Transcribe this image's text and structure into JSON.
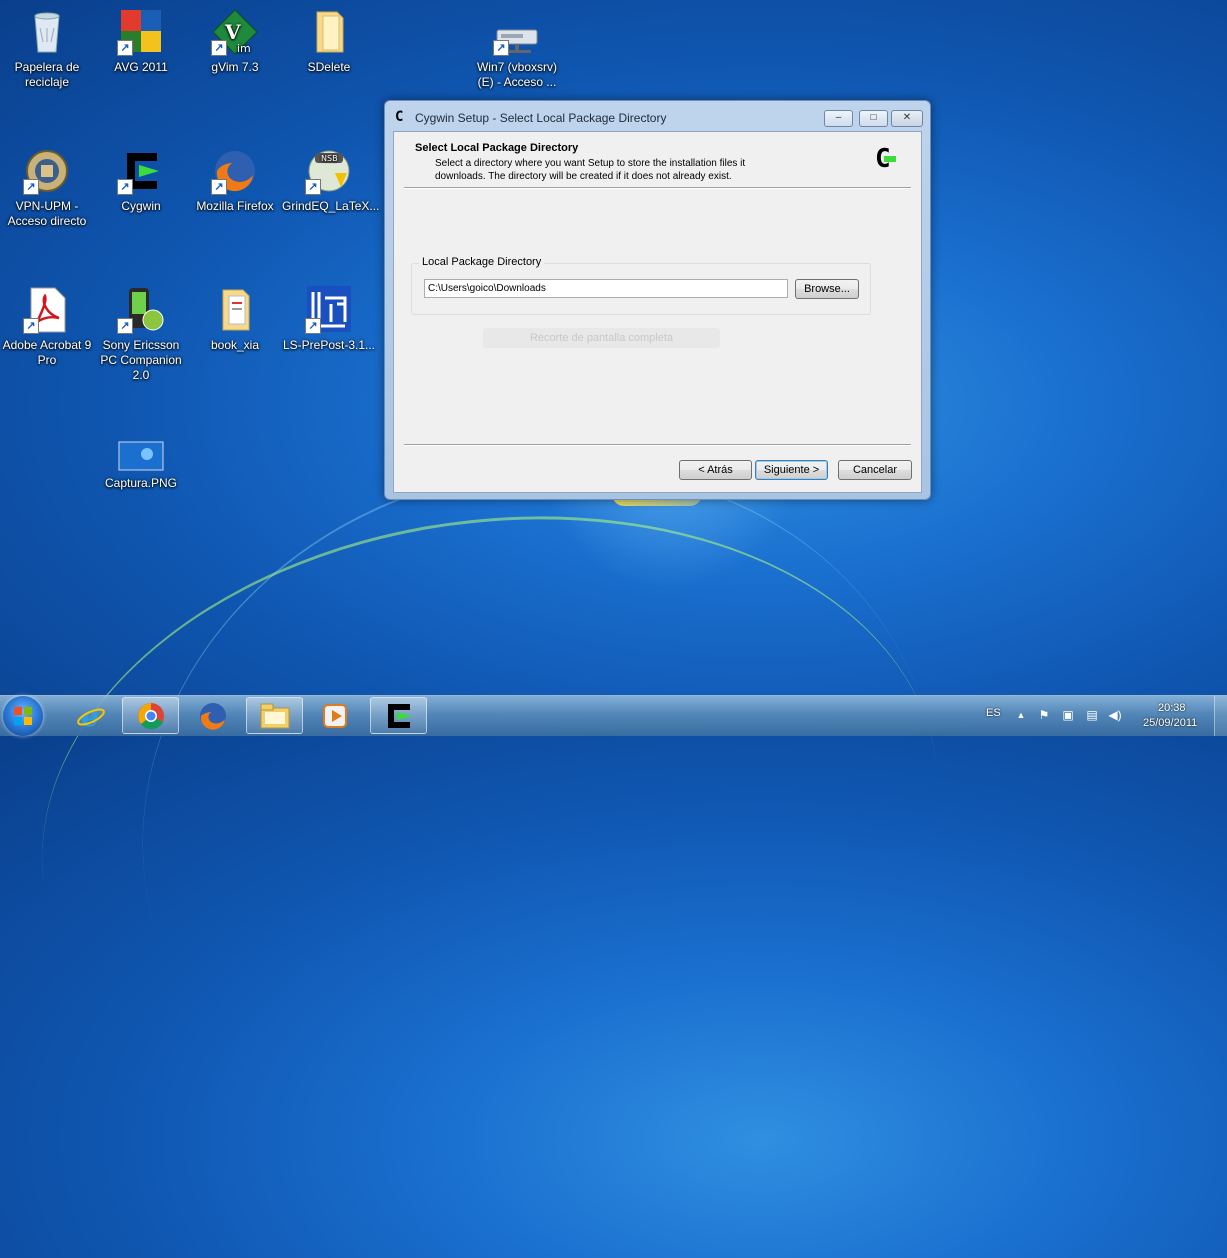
{
  "desktop": {
    "icons": [
      {
        "label": "Papelera de reciclaje",
        "icon": "recycle-bin-icon"
      },
      {
        "label": "AVG 2011",
        "icon": "avg-icon"
      },
      {
        "label": "gVim 7.3",
        "icon": "gvim-icon"
      },
      {
        "label": "SDelete",
        "icon": "folder-icon"
      },
      {
        "label": "Win7 (vboxsrv) (E) - Acceso ...",
        "icon": "network-drive-icon"
      },
      {
        "label": "VPN-UPM - Acceso directo",
        "icon": "vpn-upm-icon"
      },
      {
        "label": "Cygwin",
        "icon": "cygwin-icon"
      },
      {
        "label": "Mozilla Firefox",
        "icon": "firefox-icon"
      },
      {
        "label": "GrindEQ_LaTeX...",
        "icon": "grindeq-icon"
      },
      {
        "label": "Adobe Acrobat 9 Pro",
        "icon": "acrobat-icon"
      },
      {
        "label": "Sony Ericsson PC Companion 2.0",
        "icon": "phone-icon"
      },
      {
        "label": "book_xia",
        "icon": "folder-docs-icon"
      },
      {
        "label": "LS-PrePost-3.1...",
        "icon": "lsprepost-icon"
      },
      {
        "label": "Captura.PNG",
        "icon": "image-file-icon"
      }
    ]
  },
  "dialog": {
    "title": "Cygwin Setup - Select Local Package Directory",
    "controls": {
      "minimize": "–",
      "maximize": "□",
      "close": "✕"
    },
    "header_title": "Select Local Package Directory",
    "header_desc": "Select a directory where you want Setup to store the installation files it downloads.  The directory will be created if it does not already exist.",
    "group_label": "Local Package Directory",
    "path_value": "C:\\Users\\goico\\Downloads",
    "browse_label": "Browse...",
    "ghost_text": "Recorte de pantalla completa",
    "back_label": "< Atrás",
    "next_label": "Siguiente >",
    "cancel_label": "Cancelar"
  },
  "taskbar": {
    "pinned": [
      "ie-icon",
      "chrome-icon",
      "firefox-icon",
      "explorer-icon",
      "media-player-icon",
      "cygwin-icon"
    ],
    "language": "ES",
    "time": "20:38",
    "date": "25/09/2011"
  }
}
